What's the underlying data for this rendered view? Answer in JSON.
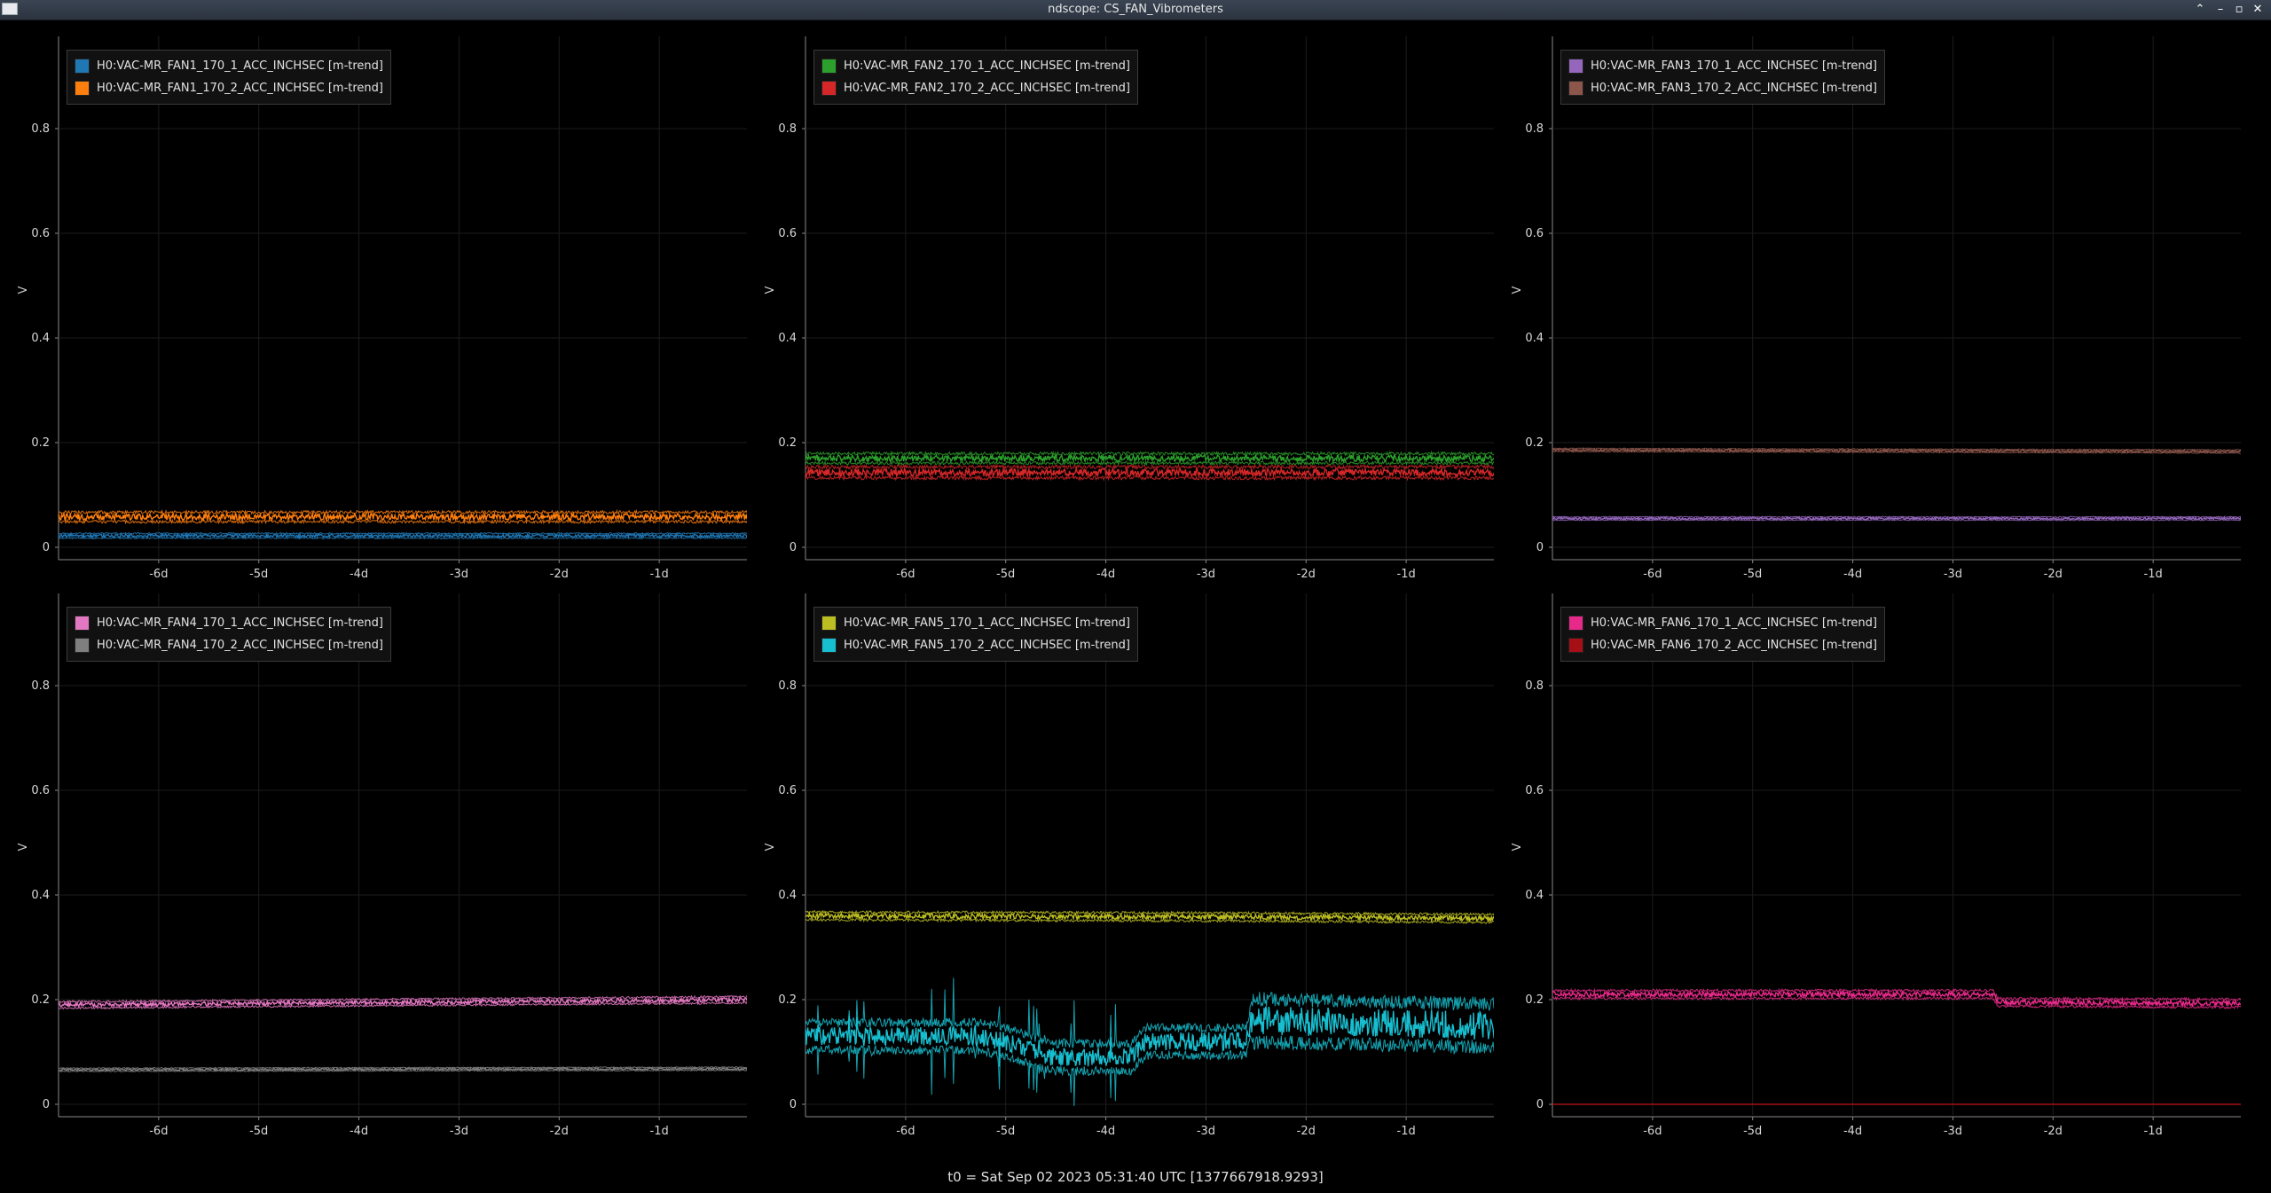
{
  "window": {
    "title": "ndscope: CS_FAN_Vibrometers",
    "buttons": [
      "⌃",
      "–",
      "▫",
      "✕"
    ]
  },
  "footer": {
    "t0_text": "t0 = Sat Sep 02 2023 05:31:40 UTC [1377667918.9293]"
  },
  "chart_data": [
    {
      "type": "line",
      "ylabel": "V",
      "ylim": [
        0,
        1.0
      ],
      "grid": true,
      "legend_position": "top-left",
      "x_ticks": [
        "-6d",
        "-5d",
        "-4d",
        "-3d",
        "-2d",
        "-1d"
      ],
      "y_ticks": [
        "0",
        "0.2",
        "0.4",
        "0.6",
        "0.8"
      ],
      "series": [
        {
          "name": "H0:VAC-MR_FAN1_170_1_ACC_INCHSEC [m-trend]",
          "color": "#1f77b4",
          "levels": [
            [
              -7.0,
              0.022
            ],
            [
              0,
              0.022
            ]
          ],
          "spread": 0.006
        },
        {
          "name": "H0:VAC-MR_FAN1_170_2_ACC_INCHSEC [m-trend]",
          "color": "#ff7f0e",
          "levels": [
            [
              -7.0,
              0.058
            ],
            [
              0,
              0.058
            ]
          ],
          "spread": 0.012
        }
      ]
    },
    {
      "type": "line",
      "ylabel": "V",
      "ylim": [
        0,
        1.0
      ],
      "grid": true,
      "legend_position": "top-left",
      "x_ticks": [
        "-6d",
        "-5d",
        "-4d",
        "-3d",
        "-2d",
        "-1d"
      ],
      "y_ticks": [
        "0",
        "0.2",
        "0.4",
        "0.6",
        "0.8"
      ],
      "series": [
        {
          "name": "H0:VAC-MR_FAN2_170_1_ACC_INCHSEC [m-trend]",
          "color": "#2ca02c",
          "levels": [
            [
              -7.0,
              0.17
            ],
            [
              0,
              0.17
            ]
          ],
          "spread": 0.012
        },
        {
          "name": "H0:VAC-MR_FAN2_170_2_ACC_INCHSEC [m-trend]",
          "color": "#d62728",
          "levels": [
            [
              -7.0,
              0.143
            ],
            [
              0,
              0.143
            ]
          ],
          "spread": 0.014
        }
      ]
    },
    {
      "type": "line",
      "ylabel": "V",
      "ylim": [
        0,
        1.0
      ],
      "grid": true,
      "legend_position": "top-left",
      "x_ticks": [
        "-6d",
        "-5d",
        "-4d",
        "-3d",
        "-2d",
        "-1d"
      ],
      "y_ticks": [
        "0",
        "0.2",
        "0.4",
        "0.6",
        "0.8"
      ],
      "series": [
        {
          "name": "H0:VAC-MR_FAN3_170_1_ACC_INCHSEC [m-trend]",
          "color": "#9467bd",
          "levels": [
            [
              -7.0,
              0.055
            ],
            [
              0,
              0.055
            ]
          ],
          "spread": 0.004
        },
        {
          "name": "H0:VAC-MR_FAN3_170_2_ACC_INCHSEC [m-trend]",
          "color": "#8c564b",
          "levels": [
            [
              -7.0,
              0.186
            ],
            [
              0,
              0.183
            ]
          ],
          "spread": 0.004
        }
      ]
    },
    {
      "type": "line",
      "ylabel": "V",
      "ylim": [
        0,
        1.0
      ],
      "grid": true,
      "legend_position": "top-left",
      "x_ticks": [
        "-6d",
        "-5d",
        "-4d",
        "-3d",
        "-2d",
        "-1d"
      ],
      "y_ticks": [
        "0",
        "0.2",
        "0.4",
        "0.6",
        "0.8"
      ],
      "series": [
        {
          "name": "H0:VAC-MR_FAN4_170_1_ACC_INCHSEC [m-trend]",
          "color": "#e377c2",
          "levels": [
            [
              -7.0,
              0.19
            ],
            [
              -3.5,
              0.195
            ],
            [
              0,
              0.2
            ]
          ],
          "spread": 0.008
        },
        {
          "name": "H0:VAC-MR_FAN4_170_2_ACC_INCHSEC [m-trend]",
          "color": "#7f7f7f",
          "levels": [
            [
              -7.0,
              0.066
            ],
            [
              0,
              0.068
            ]
          ],
          "spread": 0.004
        }
      ]
    },
    {
      "type": "line",
      "ylabel": "V",
      "ylim": [
        0,
        1.0
      ],
      "grid": true,
      "legend_position": "top-left",
      "x_ticks": [
        "-6d",
        "-5d",
        "-4d",
        "-3d",
        "-2d",
        "-1d"
      ],
      "y_ticks": [
        "0",
        "0.2",
        "0.4",
        "0.6",
        "0.8"
      ],
      "series": [
        {
          "name": "H0:VAC-MR_FAN5_170_1_ACC_INCHSEC [m-trend]",
          "color": "#bcbd22",
          "levels": [
            [
              -7.0,
              0.36
            ],
            [
              -2.6,
              0.358
            ],
            [
              0,
              0.355
            ]
          ],
          "spread": 0.01
        },
        {
          "name": "H0:VAC-MR_FAN5_170_2_ACC_INCHSEC [m-trend]",
          "color": "#17becf",
          "levels": [
            [
              -7.0,
              0.13
            ],
            [
              -5.3,
              0.13
            ],
            [
              -5.0,
              0.12
            ],
            [
              -4.55,
              0.09
            ],
            [
              -3.75,
              0.09
            ],
            [
              -3.6,
              0.12
            ],
            [
              -2.6,
              0.12
            ],
            [
              -2.55,
              0.16
            ],
            [
              0,
              0.15
            ]
          ],
          "spread": 0.035
        }
      ]
    },
    {
      "type": "line",
      "ylabel": "V",
      "ylim": [
        0,
        1.0
      ],
      "grid": true,
      "legend_position": "top-left",
      "x_ticks": [
        "-6d",
        "-5d",
        "-4d",
        "-3d",
        "-2d",
        "-1d"
      ],
      "y_ticks": [
        "0",
        "0.2",
        "0.4",
        "0.6",
        "0.8"
      ],
      "series": [
        {
          "name": "H0:VAC-MR_FAN6_170_1_ACC_INCHSEC [m-trend]",
          "color": "#e7298a",
          "levels": [
            [
              -7.0,
              0.21
            ],
            [
              -2.6,
              0.21
            ],
            [
              -2.55,
              0.195
            ],
            [
              0,
              0.193
            ]
          ],
          "spread": 0.01
        },
        {
          "name": "H0:VAC-MR_FAN6_170_2_ACC_INCHSEC [m-trend]",
          "color": "#a50f15",
          "levels": [
            [
              -7.0,
              0.0
            ],
            [
              0,
              0.0
            ]
          ],
          "spread": 0.0
        }
      ]
    }
  ]
}
